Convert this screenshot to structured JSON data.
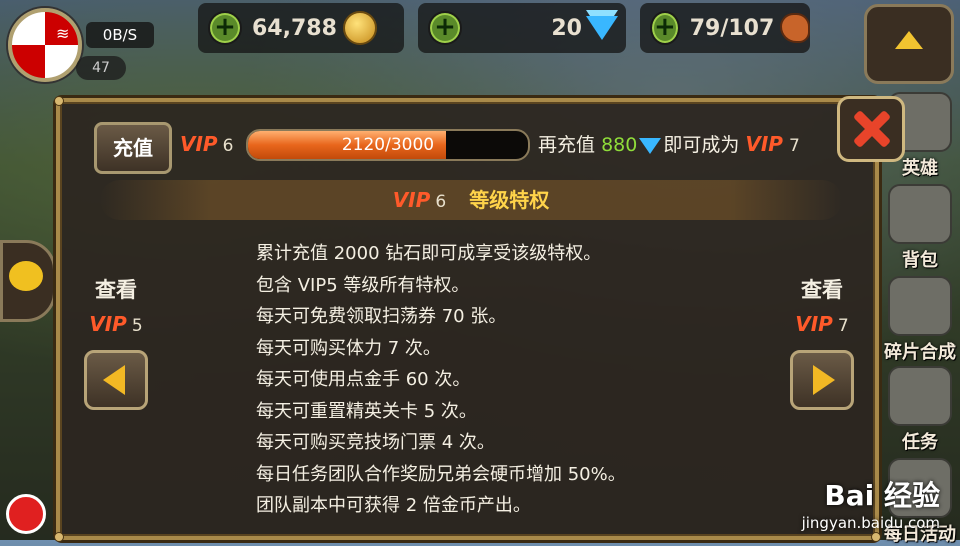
{
  "top": {
    "network": "0B/S",
    "vip_label": "VIP 6",
    "level": "47",
    "gold": "64,788",
    "diamonds": "20",
    "stamina": "79/107"
  },
  "side_menu": [
    "英雄",
    "背包",
    "碎片合成",
    "任务",
    "每日活动"
  ],
  "dialog": {
    "charge_button": "充值",
    "current_vip_word": "VIP",
    "current_vip_num": "6",
    "progress": {
      "text": "2120/3000",
      "current": 2120,
      "max": 3000
    },
    "more_prefix": "再充值",
    "more_amount": "880",
    "more_suffix": "即可成为",
    "next_vip_word": "VIP",
    "next_vip_num": "7",
    "banner_vip_word": "VIP",
    "banner_vip_num": "6",
    "banner_title": "等级特权",
    "perks": [
      "累计充值 2000 钻石即可成享受该级特权。",
      "包含 VIP5 等级所有特权。",
      "每天可免费领取扫荡券 70 张。",
      "每天可购买体力 7 次。",
      "每天可使用点金手 60 次。",
      "每天可重置精英关卡 5 次。",
      "每天可购买竞技场门票 4 次。",
      "每日任务团队合作奖励兄弟会硬币增加 50%。",
      "团队副本中可获得 2 倍金币产出。"
    ],
    "prev": {
      "label": "查看",
      "vip_word": "VIP",
      "vip_num": "5"
    },
    "next": {
      "label": "查看",
      "vip_word": "VIP",
      "vip_num": "7"
    }
  },
  "watermark": {
    "brand": "Bai 经验",
    "url": "jingyan.baidu.com"
  }
}
